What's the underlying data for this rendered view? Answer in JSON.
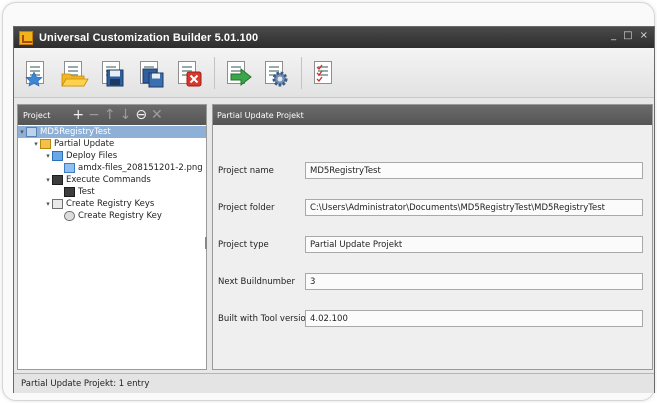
{
  "window": {
    "title": "Universal Customization Builder 5.01.100",
    "controls": [
      "_",
      "□",
      "×"
    ]
  },
  "toolbar": {
    "buttons": [
      {
        "name": "new-project",
        "icon": "document-star-icon"
      },
      {
        "name": "open-project",
        "icon": "folder-open-icon"
      },
      {
        "name": "save-project",
        "icon": "floppy-disk-icon"
      },
      {
        "name": "save-all",
        "icon": "floppy-disks-icon"
      },
      {
        "name": "close-project",
        "icon": "document-close-icon"
      },
      {
        "name": "build",
        "icon": "document-arrow-icon"
      },
      {
        "name": "settings",
        "icon": "document-gear-icon"
      },
      {
        "name": "checklist",
        "icon": "checklist-icon"
      }
    ]
  },
  "left_panel": {
    "title": "Project",
    "tools": [
      "+",
      "−",
      "↑",
      "↓",
      "⊖",
      "✕"
    ],
    "tree": [
      {
        "label": "MD5RegistryTest",
        "level": 0,
        "expanded": true,
        "icon": "project-icon",
        "selected": true
      },
      {
        "label": "Partial Update",
        "level": 1,
        "expanded": true,
        "icon": "package-icon"
      },
      {
        "label": "Deploy Files",
        "level": 2,
        "expanded": true,
        "icon": "folder-icon"
      },
      {
        "label": "amdx-files_208151201-2.png",
        "level": 3,
        "icon": "image-file-icon"
      },
      {
        "label": "Execute Commands",
        "level": 2,
        "expanded": true,
        "icon": "terminal-icon"
      },
      {
        "label": "Test",
        "level": 3,
        "icon": "terminal-icon"
      },
      {
        "label": "Create Registry Keys",
        "level": 2,
        "expanded": true,
        "icon": "registry-icon"
      },
      {
        "label": "Create Registry Key",
        "level": 3,
        "icon": "registry-key-icon"
      }
    ]
  },
  "right_panel": {
    "title": "Partial Update Projekt",
    "fields": [
      {
        "label": "Project name",
        "value": "MD5RegistryTest"
      },
      {
        "label": "Project folder",
        "value": "C:\\Users\\Administrator\\Documents\\MD5RegistryTest\\MD5RegistryTest"
      },
      {
        "label": "Project type",
        "value": "Partial Update Projekt"
      },
      {
        "label": "Next Buildnumber",
        "value": "3"
      },
      {
        "label": "Built with Tool version",
        "value": "4.02.100"
      }
    ]
  },
  "status": {
    "text": "Partial Update Projekt: 1 entry"
  },
  "colors": {
    "titlebar": "#2d2d2d",
    "panel_header": "#5f5f5f",
    "selection": "#8fb0d6",
    "accent": "#f2b21b"
  }
}
